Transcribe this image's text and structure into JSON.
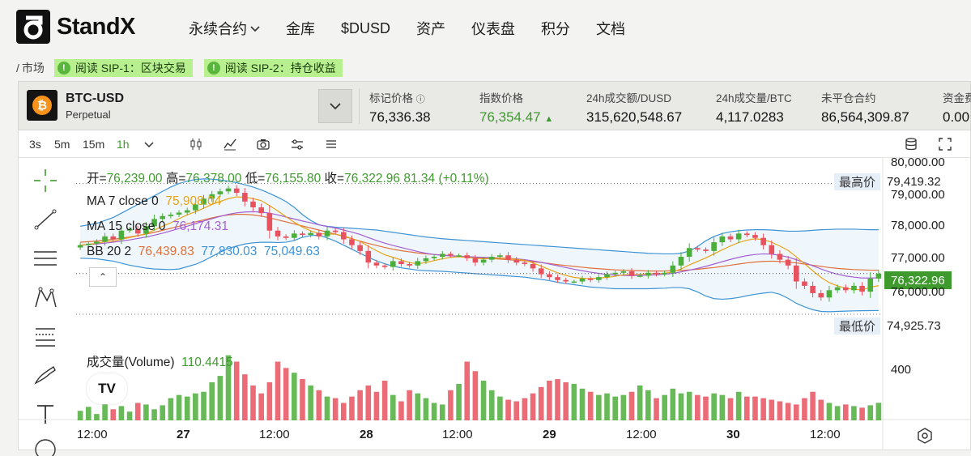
{
  "brand": {
    "name": "StandX"
  },
  "nav": {
    "items": [
      {
        "label": "永续合约",
        "has_dropdown": true
      },
      {
        "label": "金库"
      },
      {
        "label": "$DUSD"
      },
      {
        "label": "资产"
      },
      {
        "label": "仪表盘"
      },
      {
        "label": "积分"
      },
      {
        "label": "文档"
      }
    ]
  },
  "breadcrumb": {
    "prefix": "/",
    "market": "市场"
  },
  "banners": [
    {
      "label": "阅读 SIP-1：区块交易"
    },
    {
      "label": "阅读 SIP-2：持仓收益"
    }
  ],
  "market": {
    "symbol": "BTC-USD",
    "type": "Perpetual",
    "coin_glyph": "₿",
    "stats": [
      {
        "label": "标记价格",
        "value": "76,336.38",
        "info_icon": true
      },
      {
        "label": "指数价格",
        "value": "76,354.47",
        "color": "#3f9a2e",
        "arrow": "▲"
      },
      {
        "label": "24h成交额/DUSD",
        "value": "315,620,548.67"
      },
      {
        "label": "24h成交量/BTC",
        "value": "4,117.0283"
      },
      {
        "label": "未平仓合约",
        "value": "86,564,309.87"
      },
      {
        "label": "资金费",
        "value": "0.00"
      }
    ]
  },
  "toolbar": {
    "intervals": [
      "3s",
      "5m",
      "15m",
      "1h"
    ],
    "active_interval": "1h"
  },
  "legend": {
    "ohlc": {
      "open_label": "开=",
      "open": "76,239.00",
      "high_label": "高=",
      "high": "76,378.00",
      "low_label": "低=",
      "low": "76,155.80",
      "close_label": "收=",
      "close": "76,322.96",
      "change": "81.34 (+0.11%)"
    },
    "ma7": {
      "label": "MA 7 close 0",
      "value": "75,908.04",
      "color": "#e8a317"
    },
    "ma15": {
      "label": "MA 15 close 0",
      "value": "76,174.31",
      "color": "#a45fd3"
    },
    "bb": {
      "label": "BB 20 2",
      "values": [
        "76,439.83",
        "77,830.03",
        "75,049.63"
      ],
      "colors": [
        "#e0703a",
        "#3d93d4",
        "#3d93d4"
      ]
    },
    "volume": {
      "label": "成交量(Volume)",
      "value": "110.4415"
    },
    "collapse_glyph": "⌃",
    "tv_logo": "TV"
  },
  "price_tags": {
    "high": {
      "label": "最高价",
      "value": "79,419.32"
    },
    "low": {
      "label": "最低价",
      "value": "74,925.73"
    },
    "current": {
      "value": "76,322.96"
    }
  },
  "axes": {
    "y_ticks": [
      "80,000.00",
      "79,000.00",
      "78,000.00",
      "77,000.00",
      "76,000.00"
    ],
    "volume_tick": "400",
    "x_ticks": [
      {
        "label": "12:00",
        "bold": false
      },
      {
        "label": "27",
        "bold": true
      },
      {
        "label": "12:00",
        "bold": false
      },
      {
        "label": "28",
        "bold": true
      },
      {
        "label": "12:00",
        "bold": false
      },
      {
        "label": "29",
        "bold": true
      },
      {
        "label": "12:00",
        "bold": false
      },
      {
        "label": "30",
        "bold": true
      },
      {
        "label": "12:00",
        "bold": false
      }
    ]
  },
  "colors": {
    "up": "#4cae3a",
    "down": "#e8525f",
    "ma7": "#e8a317",
    "ma15": "#a45fd3",
    "bb_mid": "#e0703a",
    "bb_band": "#3d93d4",
    "accent": "#3f9a2e"
  },
  "chart_data": {
    "type": "candlestick",
    "title": "",
    "xlabel": "",
    "ylabel": "",
    "ylim": [
      74700,
      80300
    ],
    "x_ticks": [
      "12:00",
      "27",
      "12:00",
      "28",
      "12:00",
      "29",
      "12:00",
      "30",
      "12:00"
    ],
    "high": 79419.32,
    "low": 74925.73,
    "last": 76322.96,
    "closes": [
      77300,
      77350,
      77420,
      77600,
      77500,
      77800,
      77850,
      77700,
      77950,
      78200,
      78300,
      78350,
      78420,
      78500,
      78700,
      78900,
      79050,
      79150,
      79250,
      79100,
      78800,
      78600,
      78400,
      77800,
      77600,
      77550,
      77700,
      77650,
      77720,
      77600,
      77800,
      77750,
      77500,
      77300,
      77100,
      76700,
      76600,
      76550,
      76750,
      76650,
      76600,
      76750,
      76850,
      76900,
      77000,
      76950,
      76950,
      76850,
      76700,
      76800,
      76900,
      76950,
      76800,
      76700,
      76650,
      76500,
      76300,
      76200,
      76100,
      76050,
      76050,
      76150,
      76100,
      76200,
      76300,
      76350,
      76400,
      76250,
      76250,
      76350,
      76300,
      76350,
      76600,
      76900,
      77200,
      77150,
      77100,
      77400,
      77600,
      77500,
      77700,
      77650,
      77550,
      77300,
      77000,
      76800,
      76600,
      76050,
      75900,
      75650,
      75500,
      75750,
      75850,
      75750,
      75900,
      75700,
      76150,
      76322.96
    ],
    "ma7": [
      77300,
      77330,
      77360,
      77420,
      77440,
      77500,
      77560,
      77620,
      77700,
      77820,
      77950,
      78070,
      78210,
      78340,
      78450,
      78570,
      78700,
      78800,
      78900,
      78960,
      78950,
      78900,
      78830,
      78660,
      78480,
      78280,
      78090,
      77920,
      77790,
      77700,
      77680,
      77680,
      77620,
      77530,
      77430,
      77260,
      77110,
      76970,
      76880,
      76790,
      76700,
      76660,
      76700,
      76770,
      76830,
      76880,
      76900,
      76880,
      76850,
      76830,
      76840,
      76860,
      76850,
      76810,
      76780,
      76690,
      76580,
      76460,
      76350,
      76260,
      76190,
      76160,
      76150,
      76170,
      76190,
      76230,
      76280,
      76290,
      76300,
      76320,
      76320,
      76330,
      76380,
      76480,
      76620,
      76740,
      76860,
      77000,
      77140,
      77270,
      77390,
      77470,
      77520,
      77490,
      77400,
      77270,
      77120,
      76900,
      76660,
      76420,
      76190,
      76010,
      75900,
      75820,
      75780,
      75760,
      75850,
      75908.04
    ],
    "ma15": [
      77300,
      77320,
      77340,
      77370,
      77400,
      77440,
      77480,
      77530,
      77580,
      77640,
      77710,
      77790,
      77870,
      77950,
      78040,
      78130,
      78210,
      78290,
      78360,
      78410,
      78440,
      78450,
      78440,
      78400,
      78340,
      78270,
      78200,
      78130,
      78070,
      78000,
      77940,
      77890,
      77820,
      77750,
      77670,
      77560,
      77460,
      77370,
      77290,
      77220,
      77150,
      77080,
      77020,
      76980,
      76950,
      76930,
      76920,
      76910,
      76890,
      76880,
      76870,
      76860,
      76850,
      76830,
      76800,
      76760,
      76710,
      76650,
      76590,
      76530,
      76470,
      76420,
      76370,
      76330,
      76290,
      76270,
      76260,
      76250,
      76260,
      76270,
      76280,
      76300,
      76330,
      76380,
      76440,
      76500,
      76570,
      76650,
      76730,
      76810,
      76880,
      76940,
      76980,
      77000,
      76990,
      76950,
      76890,
      76800,
      76700,
      76590,
      76480,
      76380,
      76300,
      76240,
      76200,
      76170,
      76170,
      76174.31
    ],
    "bb_mid": [
      77400,
      77420,
      77440,
      77470,
      77500,
      77540,
      77580,
      77630,
      77680,
      77740,
      77810,
      77880,
      77950,
      78030,
      78100,
      78170,
      78240,
      78300,
      78340,
      78360,
      78360,
      78340,
      78300,
      78240,
      78170,
      78100,
      78030,
      77960,
      77890,
      77820,
      77750,
      77680,
      77600,
      77520,
      77440,
      77360,
      77290,
      77220,
      77160,
      77110,
      77070,
      77030,
      77000,
      76980,
      76960,
      76940,
      76920,
      76900,
      76880,
      76860,
      76840,
      76820,
      76800,
      76780,
      76760,
      76730,
      76700,
      76670,
      76630,
      76600,
      76570,
      76540,
      76510,
      76490,
      76470,
      76450,
      76440,
      76430,
      76420,
      76410,
      76410,
      76410,
      76420,
      76430,
      76450,
      76470,
      76500,
      76530,
      76570,
      76610,
      76650,
      76690,
      76720,
      76740,
      76750,
      76740,
      76720,
      76690,
      76650,
      76610,
      76570,
      76530,
      76500,
      76480,
      76460,
      76450,
      76440,
      76439.83
    ],
    "bb_upper": [
      77950,
      78000,
      78050,
      78150,
      78250,
      78400,
      78550,
      78700,
      78850,
      79000,
      79150,
      79300,
      79420,
      79500,
      79560,
      79580,
      79570,
      79540,
      79500,
      79450,
      79380,
      79300,
      79200,
      79080,
      78950,
      78800,
      78600,
      78350,
      78150,
      78000,
      77950,
      77920,
      77900,
      77880,
      77860,
      77840,
      77820,
      77780,
      77740,
      77700,
      77660,
      77620,
      77580,
      77550,
      77520,
      77500,
      77480,
      77460,
      77440,
      77420,
      77400,
      77380,
      77360,
      77340,
      77320,
      77300,
      77280,
      77260,
      77240,
      77220,
      77200,
      77180,
      77160,
      77140,
      77120,
      77100,
      77080,
      77060,
      77040,
      77020,
      77010,
      77000,
      77000,
      77020,
      77100,
      77250,
      77450,
      77600,
      77700,
      77760,
      77800,
      77820,
      77830,
      77830,
      77820,
      77800,
      77780,
      77780,
      77790,
      77810,
      77830,
      77840,
      77850,
      77850,
      77850,
      77840,
      77830,
      77830.03
    ],
    "bb_lower": [
      76850,
      76840,
      76830,
      76790,
      76750,
      76680,
      76610,
      76560,
      76510,
      76480,
      76470,
      76460,
      76480,
      76560,
      76640,
      76760,
      76910,
      77060,
      77180,
      77270,
      77340,
      77380,
      77400,
      77400,
      77390,
      77400,
      77460,
      77570,
      77630,
      77640,
      77550,
      77440,
      77300,
      77160,
      77020,
      76880,
      76760,
      76660,
      76580,
      76520,
      76480,
      76440,
      76420,
      76410,
      76400,
      76380,
      76360,
      76340,
      76320,
      76300,
      76280,
      76260,
      76240,
      76220,
      76200,
      76160,
      76120,
      76080,
      76020,
      75980,
      75940,
      75900,
      75860,
      75840,
      75820,
      75800,
      75800,
      75800,
      75800,
      75800,
      75810,
      75820,
      75840,
      75840,
      75800,
      75690,
      75550,
      75460,
      75440,
      75460,
      75500,
      75560,
      75610,
      75650,
      75680,
      75610,
      75470,
      75300,
      75180,
      75080,
      75020,
      75010,
      75020,
      75030,
      75040,
      75045,
      75048,
      75049.63
    ],
    "volume": [
      60,
      85,
      40,
      130,
      70,
      90,
      55,
      110,
      100,
      70,
      95,
      140,
      160,
      150,
      170,
      180,
      240,
      280,
      410,
      370,
      290,
      220,
      170,
      240,
      370,
      330,
      300,
      260,
      220,
      190,
      150,
      140,
      110,
      150,
      190,
      220,
      180,
      250,
      160,
      120,
      190,
      170,
      140,
      110,
      100,
      190,
      230,
      370,
      310,
      250,
      190,
      150,
      130,
      120,
      140,
      170,
      210,
      250,
      260,
      240,
      230,
      200,
      180,
      160,
      170,
      150,
      160,
      180,
      220,
      190,
      140,
      160,
      200,
      170,
      180,
      160,
      150,
      170,
      160,
      140,
      180,
      150,
      150,
      140,
      130,
      120,
      110,
      100,
      140,
      180,
      130,
      110,
      90,
      100,
      90,
      80,
      95,
      110.4415
    ]
  }
}
